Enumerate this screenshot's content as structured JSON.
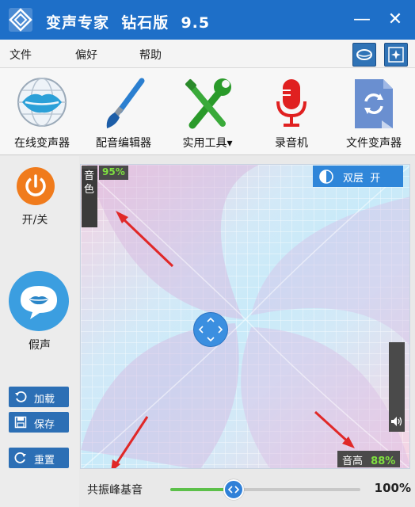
{
  "window": {
    "title": "变声专家  钻石版  9.5",
    "minimize_glyph": "—",
    "close_glyph": "✕"
  },
  "menu": {
    "items": [
      "文件",
      "偏好",
      "帮助"
    ]
  },
  "toolbar": {
    "items": [
      {
        "label": "在线变声器",
        "icon": "lips-globe-icon"
      },
      {
        "label": "配音编辑器",
        "icon": "brush-icon"
      },
      {
        "label": "实用工具▾",
        "icon": "wrench-screwdriver-icon"
      },
      {
        "label": "录音机",
        "icon": "microphone-icon"
      },
      {
        "label": "文件变声器",
        "icon": "file-refresh-icon"
      }
    ]
  },
  "sidebar": {
    "power_label": "开/关",
    "voice_label": "假声",
    "load_label": "加载",
    "save_label": "保存",
    "reset_label": "重置"
  },
  "pad": {
    "timbre_label": "音色",
    "timbre_value": "95%",
    "timbre_level": 0.95,
    "dual_label": "双层  开",
    "pitch_label": "音高",
    "pitch_value": "88%",
    "pitch_level": 0.88
  },
  "resonance": {
    "label": "共振峰基音",
    "value": "100%",
    "level": 1.0
  },
  "colors": {
    "accent": "#1e6fc8",
    "button": "#2c6fb5",
    "power": "#f07b1c",
    "value_green": "#7fe040"
  }
}
